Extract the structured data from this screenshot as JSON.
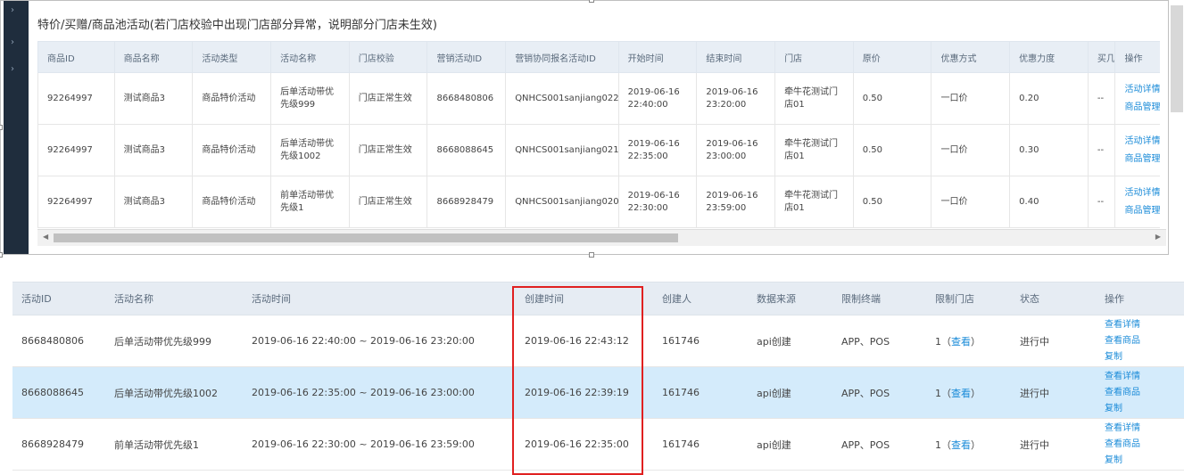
{
  "panel_title": "特价/买赠/商品池活动(若门店校验中出现门店部分异常，说明部分门店未生效)",
  "table1": {
    "headers": [
      "商品ID",
      "商品名称",
      "活动类型",
      "活动名称",
      "门店校验",
      "营销活动ID",
      "营销协同报名活动ID",
      "开始时间",
      "结束时间",
      "门店",
      "原价",
      "优惠方式",
      "优惠力度",
      "买几件",
      "操作"
    ],
    "rows": [
      {
        "id": "92264997",
        "name": "测试商品3",
        "type": "商品特价活动",
        "act_name": "后单活动带优先级999",
        "check": "门店正常生效",
        "mkt_id": "8668480806",
        "reg_id": "QNHCS001sanjiang022",
        "start": "2019-06-16 22:40:00",
        "end": "2019-06-16 23:20:00",
        "store": "牵牛花测试门店01",
        "price": "0.50",
        "method": "一口价",
        "discount": "0.20",
        "buy": "--",
        "op1": "活动详情",
        "op2": "商品管理"
      },
      {
        "id": "92264997",
        "name": "测试商品3",
        "type": "商品特价活动",
        "act_name": "后单活动带优先级1002",
        "check": "门店正常生效",
        "mkt_id": "8668088645",
        "reg_id": "QNHCS001sanjiang021",
        "start": "2019-06-16 22:35:00",
        "end": "2019-06-16 23:00:00",
        "store": "牵牛花测试门店01",
        "price": "0.50",
        "method": "一口价",
        "discount": "0.30",
        "buy": "--",
        "op1": "活动详情",
        "op2": "商品管理"
      },
      {
        "id": "92264997",
        "name": "测试商品3",
        "type": "商品特价活动",
        "act_name": "前单活动带优先级1",
        "check": "门店正常生效",
        "mkt_id": "8668928479",
        "reg_id": "QNHCS001sanjiang020",
        "start": "2019-06-16 22:30:00",
        "end": "2019-06-16 23:59:00",
        "store": "牵牛花测试门店01",
        "price": "0.50",
        "method": "一口价",
        "discount": "0.40",
        "buy": "--",
        "op1": "活动详情",
        "op2": "商品管理"
      }
    ]
  },
  "table2": {
    "headers": [
      "活动ID",
      "活动名称",
      "活动时间",
      "创建时间",
      "创建人",
      "数据来源",
      "限制终端",
      "限制门店",
      "状态",
      "操作"
    ],
    "rows": [
      {
        "id": "8668480806",
        "name": "后单活动带优先级999",
        "time": "2019-06-16 22:40:00 ~ 2019-06-16 23:20:00",
        "created": "2019-06-16 22:43:12",
        "creator": "161746",
        "source": "api创建",
        "terminal": "APP、POS",
        "store_count": "1（",
        "store_link": "查看",
        "store_end": "）",
        "status": "进行中",
        "op1": "查看详情",
        "op2": "查看商品",
        "op3": "复制"
      },
      {
        "id": "8668088645",
        "name": "后单活动带优先级1002",
        "time": "2019-06-16 22:35:00 ~ 2019-06-16 23:00:00",
        "created": "2019-06-16 22:39:19",
        "creator": "161746",
        "source": "api创建",
        "terminal": "APP、POS",
        "store_count": "1（",
        "store_link": "查看",
        "store_end": "）",
        "status": "进行中",
        "op1": "查看详情",
        "op2": "查看商品",
        "op3": "复制"
      },
      {
        "id": "8668928479",
        "name": "前单活动带优先级1",
        "time": "2019-06-16 22:30:00 ~ 2019-06-16 23:59:00",
        "created": "2019-06-16 22:35:00",
        "creator": "161746",
        "source": "api创建",
        "terminal": "APP、POS",
        "store_count": "1（",
        "store_link": "查看",
        "store_end": "）",
        "status": "进行中",
        "op1": "查看详情",
        "op2": "查看商品",
        "op3": "复制"
      }
    ]
  },
  "colors": {
    "link": "#1a8bd8",
    "status_green": "#19a319",
    "highlight_box": "#e02020",
    "selected_row": "#d4ebfb"
  }
}
